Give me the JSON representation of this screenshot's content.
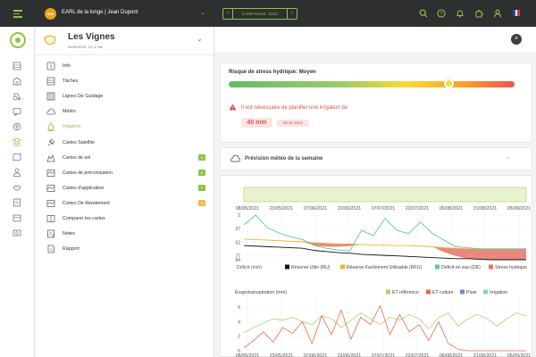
{
  "topbar": {
    "avatar_initials": "WW",
    "farm_label": "EARL de la longe | Jean Dupont",
    "campaign_label": "CAMPAGNE: 2021",
    "icons": [
      "search-icon",
      "help-icon",
      "bell-icon",
      "puzzle-icon",
      "user-icon"
    ]
  },
  "field": {
    "name": "Les Vignes",
    "surface": "SURFACE: 22.1 HA"
  },
  "menu": [
    {
      "label": "Info",
      "icon": "info-icon"
    },
    {
      "label": "Tâches",
      "icon": "tasks-icon"
    },
    {
      "label": "Lignes De Guidage",
      "icon": "guidance-lines-icon"
    },
    {
      "label": "Météo",
      "icon": "weather-icon"
    },
    {
      "label": "Irrigation",
      "icon": "irrigation-icon",
      "active": true
    },
    {
      "label": "Cartes Satellite",
      "icon": "satellite-icon"
    },
    {
      "label": "Cartes de sol",
      "icon": "soil-map-icon",
      "badge": "3",
      "badge_color": "#8dc63f"
    },
    {
      "label": "Cartes de préconisation",
      "icon": "prescription-map-icon",
      "badge": "6",
      "badge_color": "#8dc63f"
    },
    {
      "label": "Cartes d'application",
      "icon": "application-map-icon",
      "badge": "7",
      "badge_color": "#8dc63f"
    },
    {
      "label": "Cartes De Rendement",
      "icon": "yield-map-icon",
      "badge": "8",
      "badge_color": "#f5b942"
    },
    {
      "label": "Comparer les cartes",
      "icon": "compare-maps-icon"
    },
    {
      "label": "Notes",
      "icon": "notes-icon"
    },
    {
      "label": "Rapport",
      "icon": "report-icon"
    }
  ],
  "stress": {
    "title": "Risque de stress hydrique: Moyen",
    "level": 0.77,
    "warning": "Il est nécessaire de planifier une irrigation de",
    "amount": "40 mm",
    "date": "05.11.2021"
  },
  "meteo": {
    "title": "Prévision météo de la semaine"
  },
  "colors": {
    "accent": "#8dc63f",
    "danger": "#d9534f"
  },
  "chart_data": [
    {
      "type": "line",
      "title": "",
      "xlabel": "",
      "ylabel": "Déficit (mm)",
      "x_ticks": [
        "08/05/2021",
        "23/05/2021",
        "07/06/2021",
        "22/06/2021",
        "07/07/2021",
        "22/07/2021",
        "06/08/2021",
        "21/08/2021",
        "05/09/2021"
      ],
      "y_ticks": [
        2,
        27,
        52,
        77,
        84
      ],
      "ylim": [
        2,
        84
      ],
      "y_inverted": true,
      "legend_position": "bottom",
      "series": [
        {
          "name": "Réserve Utile (RU)",
          "color": "#111111",
          "values": [
            58,
            59,
            60,
            61,
            62,
            63,
            67,
            69,
            71,
            72,
            74,
            75,
            76,
            77,
            78,
            79,
            80,
            81,
            82,
            82,
            83,
            84,
            84,
            84,
            84
          ]
        },
        {
          "name": "Réserve Facilement Utilisable (RFU)",
          "color": "#f0b429",
          "values": [
            46,
            47,
            48,
            49,
            50,
            51,
            53,
            54,
            55,
            55,
            56,
            57,
            57,
            58,
            58,
            59,
            60,
            62,
            63,
            64,
            64,
            64,
            64,
            64,
            64
          ]
        },
        {
          "name": "Déficit en eau (DE)",
          "color": "#5cc5b5",
          "values": [
            20,
            2,
            25,
            35,
            42,
            47,
            58,
            63,
            66,
            68,
            30,
            40,
            8,
            30,
            36,
            15,
            35,
            48,
            60,
            62,
            64,
            64,
            64,
            64,
            64
          ]
        },
        {
          "name": "Stress hydrique",
          "color": "#e57368",
          "values": [
            0,
            0,
            0,
            0,
            0,
            0,
            5,
            6,
            5,
            4,
            0,
            0,
            0,
            0,
            0,
            0,
            0,
            8,
            14,
            18,
            20,
            20,
            20,
            20,
            20
          ]
        }
      ]
    },
    {
      "type": "line",
      "title": "Évapotranspiration (mm)",
      "xlabel": "",
      "ylabel": "",
      "x_ticks": [
        "08/05/2021",
        "23/05/2021",
        "07/06/2021",
        "22/06/2021",
        "07/07/2021",
        "22/07/2021",
        "06/08/2021",
        "21/08/2021",
        "05/09/2021"
      ],
      "y_ticks": [
        0,
        2,
        4,
        6
      ],
      "ylim": [
        0,
        7
      ],
      "legend_position": "top-right",
      "series": [
        {
          "name": "ET référence",
          "color": "#b5cf6b",
          "values": [
            2.5,
            3.2,
            3.8,
            4.4,
            4.2,
            4.6,
            4.0,
            3.6,
            4.8,
            4.4,
            3.2,
            4.2,
            5.2,
            4.4,
            3.6,
            4.6,
            4.2,
            5.0,
            4.4,
            3.0,
            4.6,
            5.2,
            3.4,
            4.4,
            5.0,
            4.4,
            3.4,
            4.4,
            5.2,
            4.8
          ]
        },
        {
          "name": "ET culture",
          "color": "#e86b4f",
          "values": [
            0.4,
            1.4,
            2.6,
            1.2,
            3.2,
            2.4,
            4.0,
            1.0,
            4.8,
            2.2,
            5.6,
            1.6,
            4.6,
            3.6,
            6.2,
            2.2,
            5.0,
            2.6,
            3.6,
            1.4,
            4.0,
            1.0,
            0.2,
            0.0,
            0.0,
            0.0,
            0.0,
            0.0,
            0.0,
            0.0
          ]
        },
        {
          "name": "Pluie",
          "color": "#6a8fd8",
          "values": []
        },
        {
          "name": "Irrigation",
          "color": "#7fd1e0",
          "values": []
        }
      ]
    }
  ]
}
